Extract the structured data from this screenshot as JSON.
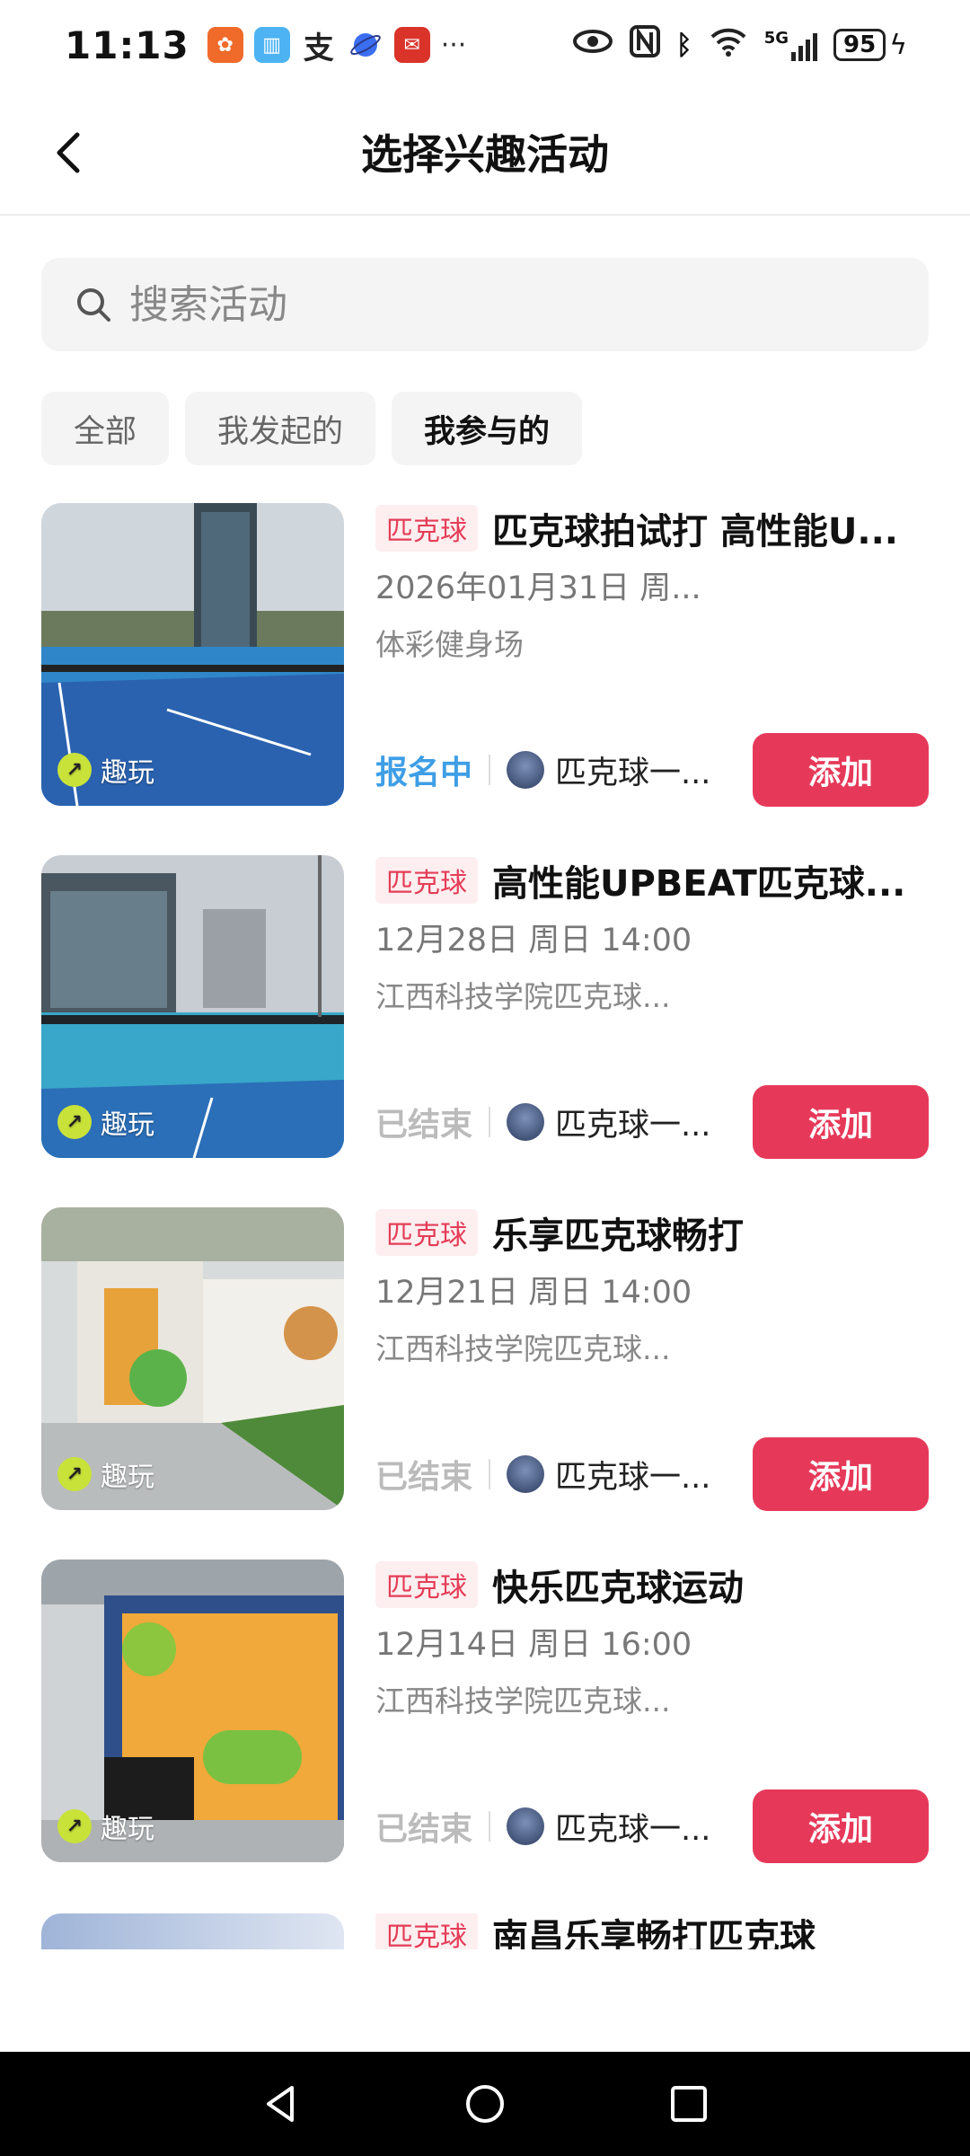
{
  "status_bar": {
    "time": "11:13",
    "battery": "95",
    "network": "5G"
  },
  "header": {
    "title": "选择兴趣活动"
  },
  "search": {
    "placeholder": "搜索活动"
  },
  "tabs": [
    {
      "label": "全部"
    },
    {
      "label": "我发起的"
    },
    {
      "label": "我参与的"
    }
  ],
  "badge_label": "趣玩",
  "add_label": "添加",
  "items": [
    {
      "tag": "匹克球",
      "title": "匹克球拍试打 高性能U...",
      "date": "2026年01月31日 周...",
      "venue": "体彩健身场",
      "status": "报名中",
      "organizer": "匹克球一..."
    },
    {
      "tag": "匹克球",
      "title": "高性能UPBEAT匹克球...",
      "date": "12月28日 周日  14:00",
      "venue": "江西科技学院匹克球...",
      "status": "已结束",
      "organizer": "匹克球一..."
    },
    {
      "tag": "匹克球",
      "title": "乐享匹克球畅打",
      "date": "12月21日 周日  14:00",
      "venue": "江西科技学院匹克球...",
      "status": "已结束",
      "organizer": "匹克球一..."
    },
    {
      "tag": "匹克球",
      "title": "快乐匹克球运动",
      "date": "12月14日 周日  16:00",
      "venue": "江西科技学院匹克球...",
      "status": "已结束",
      "organizer": "匹克球一..."
    },
    {
      "tag": "匹克球",
      "title": "南昌乐享畅打匹克球"
    }
  ],
  "colors": {
    "accent": "#e6395a",
    "status_open": "#3e9ee6",
    "tag_bg": "#fdeef0"
  }
}
